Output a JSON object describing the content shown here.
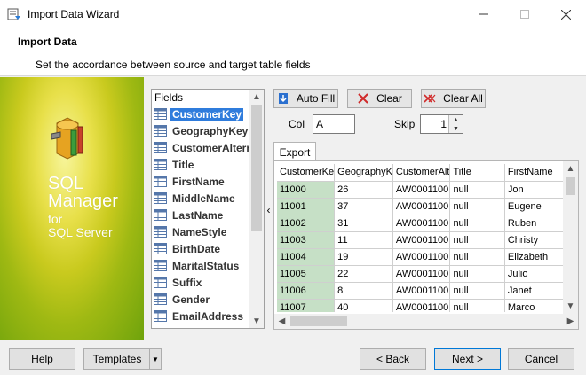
{
  "window": {
    "title": "Import Data Wizard",
    "minimize_icon": "minimize-icon",
    "maximize_icon": "maximize-icon",
    "close_icon": "close-icon"
  },
  "header": {
    "title": "Import Data",
    "subtitle": "Set the accordance between source and target table fields"
  },
  "banner": {
    "line1": "SQL",
    "line2": "Manager",
    "line3": "for",
    "line4": "SQL Server"
  },
  "fields": {
    "header": "Fields",
    "items": [
      {
        "label": "CustomerKey",
        "selected": true
      },
      {
        "label": "GeographyKey"
      },
      {
        "label": "CustomerAlternateKey"
      },
      {
        "label": "Title"
      },
      {
        "label": "FirstName"
      },
      {
        "label": "MiddleName"
      },
      {
        "label": "LastName"
      },
      {
        "label": "NameStyle"
      },
      {
        "label": "BirthDate"
      },
      {
        "label": "MaritalStatus"
      },
      {
        "label": "Suffix"
      },
      {
        "label": "Gender"
      },
      {
        "label": "EmailAddress"
      }
    ]
  },
  "toolbar": {
    "auto_fill": "Auto Fill",
    "clear": "Clear",
    "clear_all": "Clear All",
    "col_label": "Col",
    "col_value": "A",
    "skip_label": "Skip",
    "skip_value": "1"
  },
  "export_tab": "Export",
  "grid": {
    "columns": [
      "CustomerKe",
      "GeographyK",
      "CustomerAlt",
      "Title",
      "FirstName"
    ],
    "rows": [
      [
        "11000",
        "26",
        "AW0001100",
        "null",
        "Jon"
      ],
      [
        "11001",
        "37",
        "AW0001100",
        "null",
        "Eugene"
      ],
      [
        "11002",
        "31",
        "AW0001100",
        "null",
        "Ruben"
      ],
      [
        "11003",
        "11",
        "AW0001100",
        "null",
        "Christy"
      ],
      [
        "11004",
        "19",
        "AW0001100",
        "null",
        "Elizabeth"
      ],
      [
        "11005",
        "22",
        "AW0001100",
        "null",
        "Julio"
      ],
      [
        "11006",
        "8",
        "AW0001100",
        "null",
        "Janet"
      ],
      [
        "11007",
        "40",
        "AW0001100",
        "null",
        "Marco"
      ]
    ]
  },
  "footer": {
    "help": "Help",
    "templates": "Templates",
    "back": "< Back",
    "next": "Next >",
    "cancel": "Cancel"
  },
  "colors": {
    "selection": "#2f7cdc",
    "key_column": "#c6e0c6",
    "banner_green": "#6fa30c"
  }
}
